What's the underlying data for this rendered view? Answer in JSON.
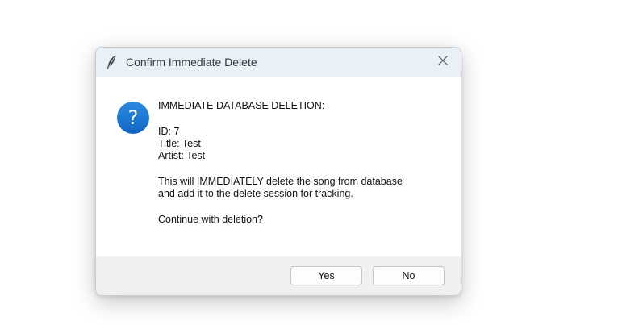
{
  "dialog": {
    "title": "Confirm Immediate Delete",
    "close_icon": "close-icon",
    "title_icon": "feather-icon",
    "question_icon": "question-icon",
    "question_glyph": "?",
    "message": {
      "heading": "IMMEDIATE DATABASE DELETION:",
      "id_line": "ID: 7",
      "title_line": "Title: Test",
      "artist_line": "Artist: Test",
      "warning_line1": "This will IMMEDIATELY delete the song from database",
      "warning_line2": "and add it to the delete session for tracking.",
      "prompt": "Continue with deletion?"
    },
    "buttons": {
      "yes": "Yes",
      "no": "No"
    }
  },
  "colors": {
    "accent": "#1a73d0",
    "titlebar": "#e9f1f6",
    "footer": "#f0f0f0"
  }
}
